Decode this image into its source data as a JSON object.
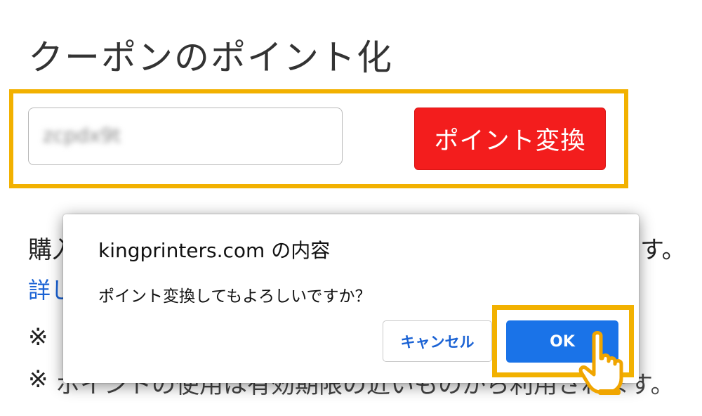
{
  "page": {
    "title": "クーポンのポイント化"
  },
  "coupon_form": {
    "input_value": "zcpdx9t",
    "convert_button_label": "ポイント変換"
  },
  "background_content": {
    "purchase_line_start": "購入",
    "purchase_line_end": "す。",
    "detail_link_start": "詳し",
    "note_1_start": "※ ",
    "note_2_start": "※ ",
    "note_2_obscured": "ポイントの使用は有効期限の近いものから利用されます。"
  },
  "dialog": {
    "origin": "kingprinters.com の内容",
    "message": "ポイント変換してもよろしいですか？",
    "cancel_label": "キャンセル",
    "ok_label": "OK"
  },
  "colors": {
    "highlight": "#f2b100",
    "convert_button": "#f31d1d",
    "ok_button": "#1a73e8",
    "link": "#1a62d4"
  },
  "icons": {
    "cursor": "hand-pointer-icon"
  }
}
